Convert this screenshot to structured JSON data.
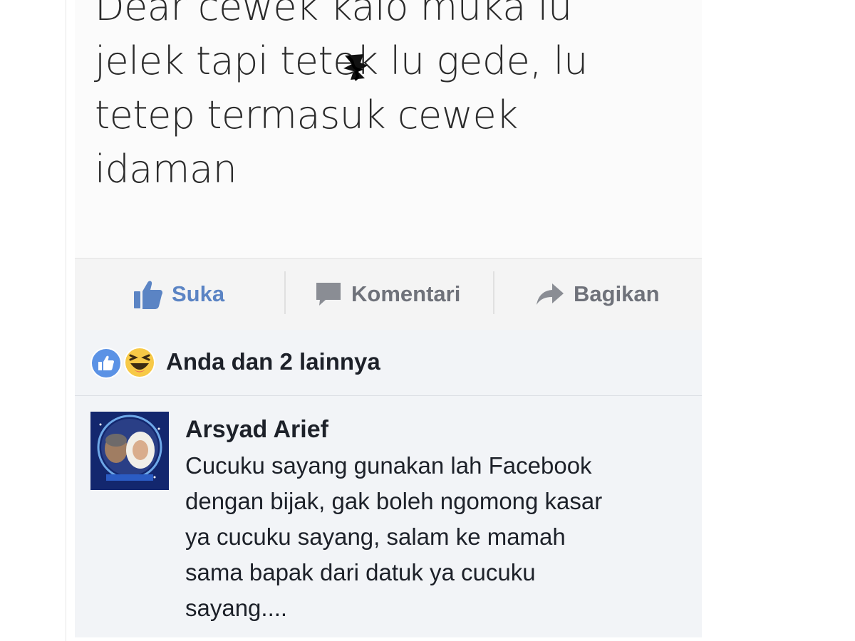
{
  "post": {
    "text": "Dear cewek kalo muka lu\njelek tapi tetek lu gede, lu\ntetep termasuk cewek\nidaman"
  },
  "actions": {
    "like_label": "Suka",
    "comment_label": "Komentari",
    "share_label": "Bagikan"
  },
  "reactions": {
    "summary": "Anda dan 2 lainnya",
    "icons": [
      "like-reaction-icon",
      "haha-reaction-icon"
    ]
  },
  "comment": {
    "author": "Arsyad Arief",
    "text": "Cucuku sayang gunakan lah Facebook\ndengan bijak, gak boleh ngomong kasar\nya cucuku sayang, salam ke mamah\nsama bapak dari datuk ya cucuku\nsayang...."
  },
  "colors": {
    "like_blue": "#5b84c4",
    "reaction_like_blue": "#5b92e5",
    "haha_yellow": "#f7c947",
    "action_gray": "#6f727a",
    "text_dark": "#1d2129"
  }
}
